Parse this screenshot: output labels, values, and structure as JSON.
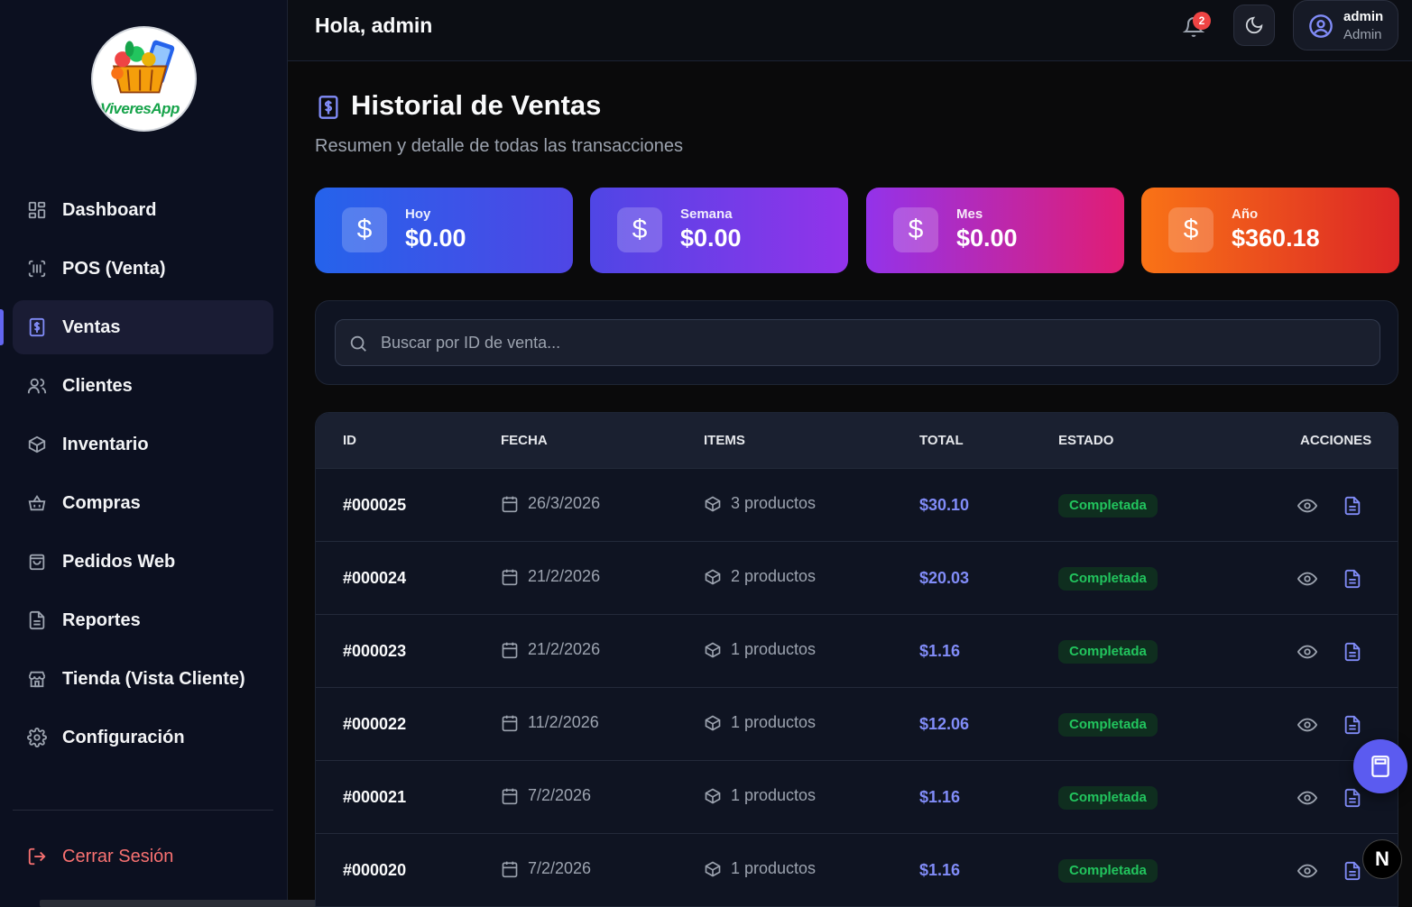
{
  "sidebar": {
    "logo_text": "ViveresApp",
    "items": [
      {
        "label": "Dashboard",
        "icon": "dashboard-icon",
        "active": false
      },
      {
        "label": "POS (Venta)",
        "icon": "scan-icon",
        "active": false
      },
      {
        "label": "Ventas",
        "icon": "receipt-icon",
        "active": true
      },
      {
        "label": "Clientes",
        "icon": "users-icon",
        "active": false
      },
      {
        "label": "Inventario",
        "icon": "package-icon",
        "active": false
      },
      {
        "label": "Compras",
        "icon": "basket-icon",
        "active": false
      },
      {
        "label": "Pedidos Web",
        "icon": "shopping-bag-icon",
        "active": false
      },
      {
        "label": "Reportes",
        "icon": "file-icon",
        "active": false
      },
      {
        "label": "Tienda (Vista Cliente)",
        "icon": "store-icon",
        "active": false
      },
      {
        "label": "Configuración",
        "icon": "gear-icon",
        "active": false
      }
    ],
    "logout_label": "Cerrar Sesión"
  },
  "header": {
    "greeting": "Hola, admin",
    "notification_count": "2",
    "user_name": "admin",
    "user_role": "Admin"
  },
  "page": {
    "title": "Historial de Ventas",
    "subtitle": "Resumen y detalle de todas las transacciones"
  },
  "stats": [
    {
      "label": "Hoy",
      "value": "$0.00",
      "gradient": [
        "#2563eb",
        "#4f46e5"
      ]
    },
    {
      "label": "Semana",
      "value": "$0.00",
      "gradient": [
        "#4f46e5",
        "#9333ea"
      ]
    },
    {
      "label": "Mes",
      "value": "$0.00",
      "gradient": [
        "#9333ea",
        "#e11d74"
      ]
    },
    {
      "label": "Año",
      "value": "$360.18",
      "gradient": [
        "#f97316",
        "#dc2626"
      ]
    }
  ],
  "search": {
    "placeholder": "Buscar por ID de venta..."
  },
  "table": {
    "headers": {
      "id": "ID",
      "fecha": "FECHA",
      "items": "ITEMS",
      "total": "TOTAL",
      "estado": "ESTADO",
      "acciones": "ACCIONES"
    },
    "rows": [
      {
        "id": "#000025",
        "fecha": "26/3/2026",
        "items": "3 productos",
        "total": "$30.10",
        "estado": "Completada"
      },
      {
        "id": "#000024",
        "fecha": "21/2/2026",
        "items": "2 productos",
        "total": "$20.03",
        "estado": "Completada"
      },
      {
        "id": "#000023",
        "fecha": "21/2/2026",
        "items": "1 productos",
        "total": "$1.16",
        "estado": "Completada"
      },
      {
        "id": "#000022",
        "fecha": "11/2/2026",
        "items": "1 productos",
        "total": "$12.06",
        "estado": "Completada"
      },
      {
        "id": "#000021",
        "fecha": "7/2/2026",
        "items": "1 productos",
        "total": "$1.16",
        "estado": "Completada"
      },
      {
        "id": "#000020",
        "fecha": "7/2/2026",
        "items": "1 productos",
        "total": "$1.16",
        "estado": "Completada"
      }
    ]
  },
  "fab_icon": "calculator-icon",
  "dev_badge": "N"
}
